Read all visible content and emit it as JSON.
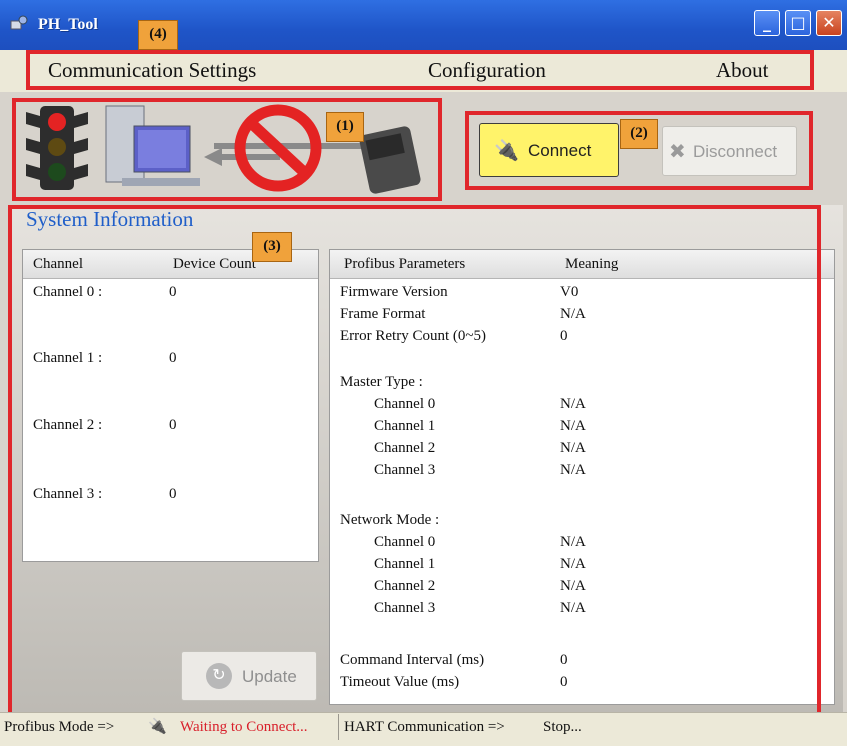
{
  "window": {
    "title": "PH_Tool"
  },
  "menu": {
    "items": [
      "Communication Settings",
      "Configuration",
      "About"
    ]
  },
  "annotations": {
    "tags": [
      "(4)",
      "(1)",
      "(2)",
      "(3)"
    ]
  },
  "toolbar": {
    "connect_label": "Connect",
    "disconnect_label": "Disconnect"
  },
  "system_info": {
    "title": "System Information",
    "channel_table": {
      "headers": [
        "Channel",
        "Device Count"
      ],
      "rows": [
        {
          "channel": "Channel 0 :",
          "count": "0"
        },
        {
          "channel": "Channel 1 :",
          "count": "0"
        },
        {
          "channel": "Channel 2 :",
          "count": "0"
        },
        {
          "channel": "Channel 3 :",
          "count": "0"
        }
      ]
    },
    "update_label": "Update",
    "params_table": {
      "headers": [
        "Profibus Parameters",
        "Meaning"
      ],
      "rows": [
        {
          "param": "Firmware Version",
          "meaning": "V0"
        },
        {
          "param": "Frame Format",
          "meaning": "N/A"
        },
        {
          "param": "Error Retry Count (0~5)",
          "meaning": "0"
        },
        {
          "param": "Master Type :",
          "meaning": ""
        },
        {
          "param": "Channel 0",
          "meaning": "N/A"
        },
        {
          "param": "Channel 1",
          "meaning": "N/A"
        },
        {
          "param": "Channel 2",
          "meaning": "N/A"
        },
        {
          "param": "Channel 3",
          "meaning": "N/A"
        },
        {
          "param": "Network Mode :",
          "meaning": ""
        },
        {
          "param": "Channel 0",
          "meaning": "N/A"
        },
        {
          "param": "Channel 1",
          "meaning": "N/A"
        },
        {
          "param": "Channel 2",
          "meaning": "N/A"
        },
        {
          "param": "Channel 3",
          "meaning": "N/A"
        },
        {
          "param": "Command Interval (ms)",
          "meaning": "0"
        },
        {
          "param": "Timeout Value (ms)",
          "meaning": "0"
        }
      ]
    }
  },
  "status": {
    "profibus_label": "Profibus Mode =>",
    "profibus_value": "Waiting to Connect...",
    "hart_label": "HART Communication =>",
    "hart_value": "Stop..."
  },
  "colors": {
    "accent": "#1f5ec9",
    "callout": "#e0262b",
    "connect_bg": "#fff36a",
    "status_warning": "#d8202b"
  }
}
